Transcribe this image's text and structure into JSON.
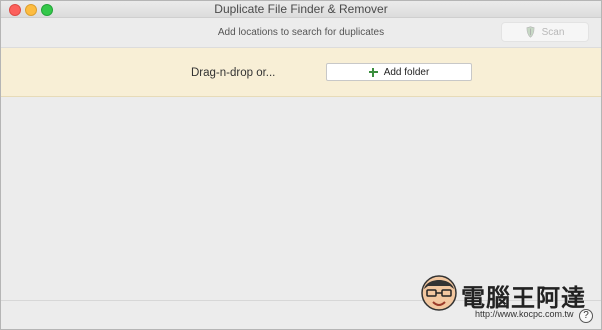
{
  "window": {
    "title": "Duplicate File Finder & Remover"
  },
  "toolbar": {
    "subtitle": "Add locations to search for duplicates",
    "scan_label": "Scan",
    "scan_icon": "scan-shield-icon"
  },
  "banner": {
    "prompt": "Drag-n-drop or...",
    "add_folder_label": "Add folder",
    "add_icon": "plus-icon",
    "background": "#f8efd6"
  },
  "footer": {
    "help_label": "?"
  },
  "watermark": {
    "text": "電腦王阿達",
    "url": "http://www.kocpc.com.tw"
  },
  "colors": {
    "close": "#fc605c",
    "minimize": "#fdbc40",
    "maximize": "#34c84a",
    "add_icon": "#3a8d3d"
  }
}
